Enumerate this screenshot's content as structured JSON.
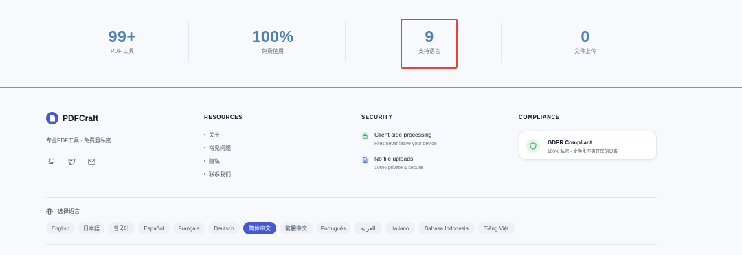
{
  "stats": [
    {
      "value": "99+",
      "label": "PDF 工具"
    },
    {
      "value": "100%",
      "label": "免费使用"
    },
    {
      "value": "9",
      "label": "支持语言"
    },
    {
      "value": "0",
      "label": "文件上传"
    }
  ],
  "brand": {
    "name": "PDFCraft",
    "tagline": "专业PDF工具 - 免费且私密"
  },
  "social": {
    "icons": [
      "github-icon",
      "twitter-icon",
      "mail-icon"
    ]
  },
  "resources": {
    "title": "RESOURCES",
    "items": [
      "关于",
      "常见问题",
      "隐私",
      "联系我们"
    ]
  },
  "security": {
    "title": "SECURITY",
    "items": [
      {
        "title": "Client-side processing",
        "subtitle": "Files never leave your device",
        "icon": "lock-icon"
      },
      {
        "title": "No file uploads",
        "subtitle": "100% private & secure",
        "icon": "file-icon"
      }
    ]
  },
  "compliance": {
    "title": "COMPLIANCE",
    "card_title": "GDPR Compliant",
    "card_subtitle": "100% 私密 - 文件永不离开您的设备",
    "icon": "shield-check-icon"
  },
  "language": {
    "heading": "选择语言",
    "icon": "globe-icon",
    "options": [
      "English",
      "日本語",
      "한국어",
      "Español",
      "Français",
      "Deutsch",
      "简体中文",
      "繁體中文",
      "Português",
      "العربية",
      "Italiano",
      "Bahasa Indonesia",
      "Tiếng Việt"
    ],
    "selected": "简体中文"
  },
  "colors": {
    "accent": "#4558d6",
    "stat_number": "#4a7fb8",
    "highlight": "#e0453a",
    "divider": "#6b8ee8"
  }
}
